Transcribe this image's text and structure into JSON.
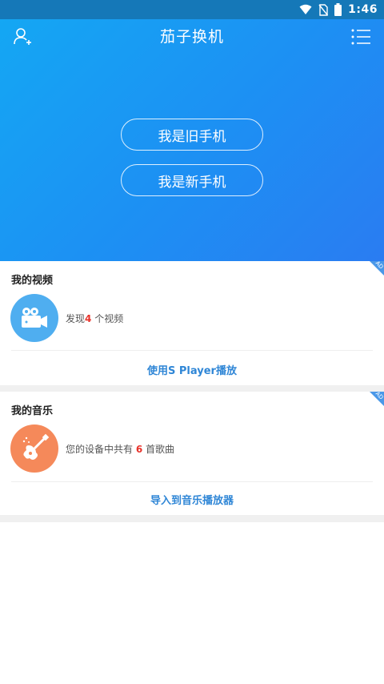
{
  "status_bar": {
    "time": "1:46",
    "icons": [
      "wifi-icon",
      "no-sim-icon",
      "battery-icon"
    ]
  },
  "header": {
    "title": "茄子换机",
    "left_icon": "add-user-icon",
    "right_icon": "menu-list-icon"
  },
  "hero": {
    "old_phone_label": "我是旧手机",
    "new_phone_label": "我是新手机",
    "gradient": [
      "#14a7f3",
      "#2a7cf2"
    ]
  },
  "video_card": {
    "title": "我的视频",
    "ad_badge": "AD",
    "icon": "video-camera-icon",
    "info_prefix": "发现",
    "count": "4",
    "info_suffix": " 个视频",
    "action": "使用S Player播放",
    "icon_color": "#4faef0"
  },
  "music_card": {
    "title": "我的音乐",
    "ad_badge": "AD",
    "icon": "guitar-icon",
    "info_prefix": "您的设备中共有 ",
    "count": "6",
    "info_suffix": " 首歌曲",
    "action": "导入到音乐播放器",
    "icon_color": "#f5895a"
  },
  "colors": {
    "accent": "#2f86d6",
    "count": "#e8322a",
    "status_bar": "#1578b8"
  }
}
